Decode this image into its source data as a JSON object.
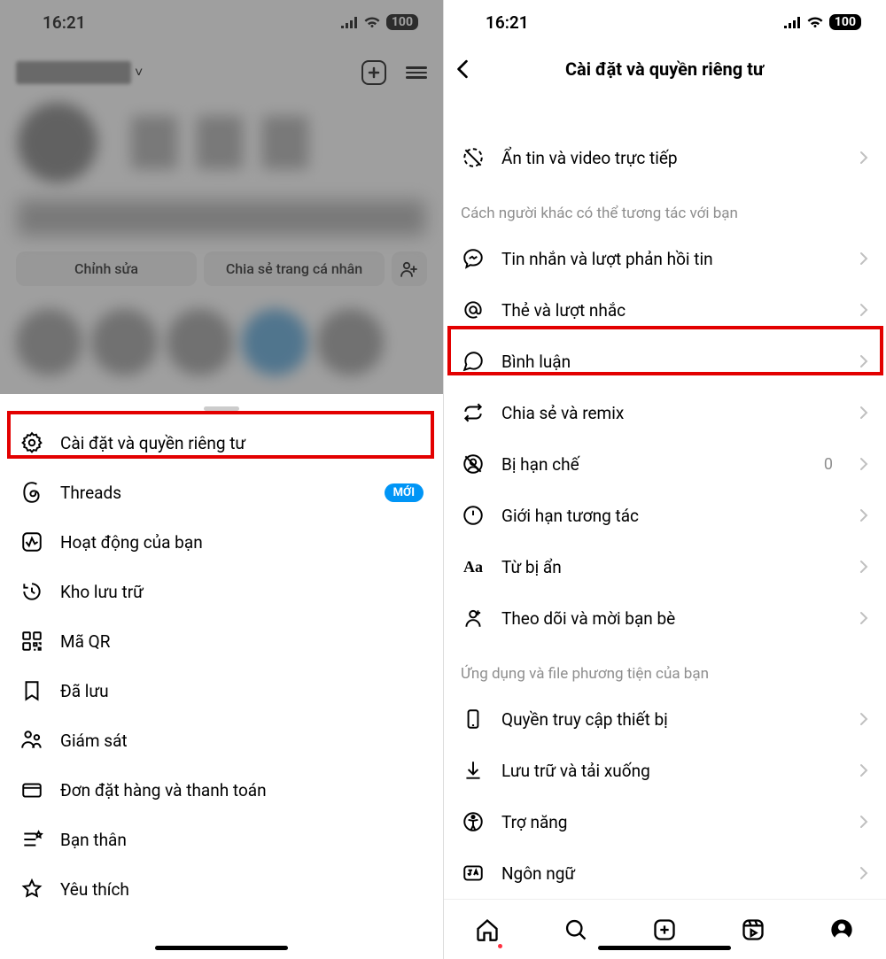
{
  "status": {
    "time": "16:21",
    "battery": "100"
  },
  "left": {
    "buttons": {
      "edit": "Chỉnh sửa",
      "share": "Chia sẻ trang cá nhân"
    },
    "menu": {
      "settings": "Cài đặt và quyền riêng tư",
      "threads": "Threads",
      "threads_badge": "MỚI",
      "activity": "Hoạt động của bạn",
      "archive": "Kho lưu trữ",
      "qr": "Mã QR",
      "saved": "Đã lưu",
      "supervision": "Giám sát",
      "orders": "Đơn đặt hàng và thanh toán",
      "close_friends": "Bạn thân",
      "favorites": "Yêu thích"
    }
  },
  "right": {
    "title": "Cài đặt và quyền riêng tư",
    "rows": {
      "hide_story": "Ẩn tin và video trực tiếp",
      "section_interact": "Cách người khác có thể tương tác với bạn",
      "messages": "Tin nhắn và lượt phản hồi tin",
      "tags": "Thẻ và lượt nhắc",
      "comments": "Bình luận",
      "share": "Chia sẻ và remix",
      "restricted": "Bị hạn chế",
      "restricted_value": "0",
      "limits": "Giới hạn tương tác",
      "hidden_words": "Từ bị ẩn",
      "follow_invite": "Theo dõi và mời bạn bè",
      "section_apps": "Ứng dụng và file phương tiện của bạn",
      "device": "Quyền truy cập thiết bị",
      "download": "Lưu trữ và tải xuống",
      "accessibility": "Trợ năng",
      "language": "Ngôn ngữ"
    }
  }
}
